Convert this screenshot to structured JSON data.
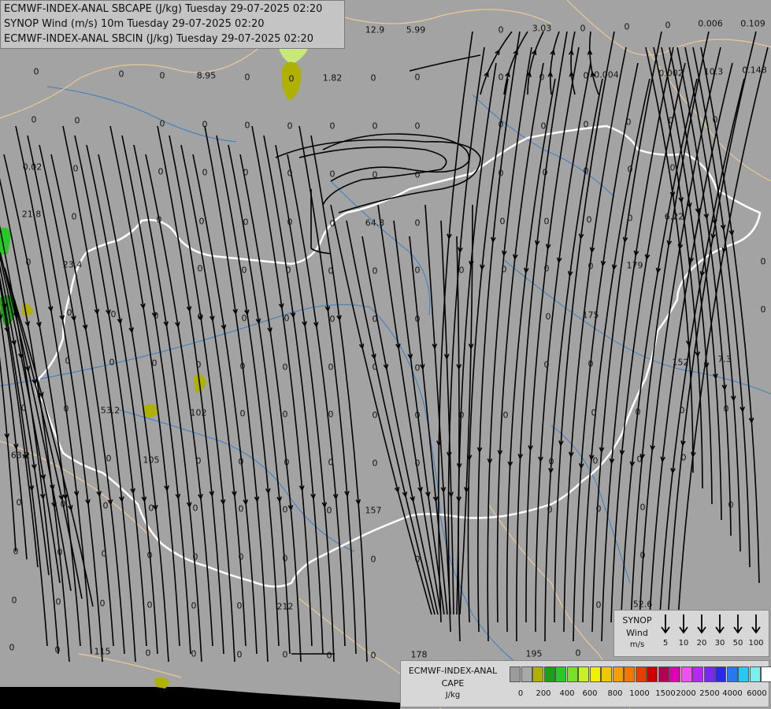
{
  "titles": [
    "ECMWF-INDEX-ANAL SBCAPE (J/kg) Tuesday 29-07-2025 02:20",
    "SYNOP Wind (m/s) 10m Tuesday 29-07-2025 02:20",
    "ECMWF-INDEX-ANAL SBCIN (J/kg) Tuesday 29-07-2025 02:20"
  ],
  "colors": {
    "background": "#a3a3a3",
    "border_white": "#ffffff",
    "region_lines": "#e8c99a",
    "rivers": "#3a7fc4",
    "streamlines": "#000000",
    "sea_black": "#000000"
  },
  "values": [
    {
      "t": "0"
    },
    {
      "t": "12.9"
    },
    {
      "t": "5.99"
    },
    {
      "t": "0"
    },
    {
      "t": "3.03"
    },
    {
      "t": "0"
    },
    {
      "t": "0"
    },
    {
      "t": "0"
    },
    {
      "t": "0.006"
    },
    {
      "t": "0.109"
    },
    {
      "t": "0"
    },
    {
      "t": "0"
    },
    {
      "t": "0"
    },
    {
      "t": "8.95"
    },
    {
      "t": "0"
    },
    {
      "t": "0"
    },
    {
      "t": "1.82"
    },
    {
      "t": "0"
    },
    {
      "t": "0"
    },
    {
      "t": "0"
    },
    {
      "t": "0"
    },
    {
      "t": "0"
    },
    {
      "t": "0.004"
    },
    {
      "t": "0.002"
    },
    {
      "t": "10.3"
    },
    {
      "t": "0.148"
    },
    {
      "t": "0"
    },
    {
      "t": "0"
    },
    {
      "t": "0"
    },
    {
      "t": "0"
    },
    {
      "t": "0"
    },
    {
      "t": "0"
    },
    {
      "t": "0"
    },
    {
      "t": "0"
    },
    {
      "t": "0"
    },
    {
      "t": "0"
    },
    {
      "t": "0"
    },
    {
      "t": "0"
    },
    {
      "t": "0"
    },
    {
      "t": "0"
    },
    {
      "t": "0"
    },
    {
      "t": "0.02"
    },
    {
      "t": "0"
    },
    {
      "t": "0"
    },
    {
      "t": "0"
    },
    {
      "t": "0"
    },
    {
      "t": "0"
    },
    {
      "t": "0"
    },
    {
      "t": "0"
    },
    {
      "t": "0"
    },
    {
      "t": "0"
    },
    {
      "t": "0"
    },
    {
      "t": "0"
    },
    {
      "t": "0"
    },
    {
      "t": "0"
    },
    {
      "t": "21.8"
    },
    {
      "t": "0"
    },
    {
      "t": "0"
    },
    {
      "t": "0"
    },
    {
      "t": "0"
    },
    {
      "t": "0"
    },
    {
      "t": "0"
    },
    {
      "t": "64.3"
    },
    {
      "t": "0"
    },
    {
      "t": "0"
    },
    {
      "t": "0"
    },
    {
      "t": "0"
    },
    {
      "t": "0"
    },
    {
      "t": "6.22"
    },
    {
      "t": "0"
    },
    {
      "t": "23.4"
    },
    {
      "t": "0"
    },
    {
      "t": "0"
    },
    {
      "t": "0"
    },
    {
      "t": "0"
    },
    {
      "t": "0"
    },
    {
      "t": "0"
    },
    {
      "t": "0"
    },
    {
      "t": "0"
    },
    {
      "t": "0"
    },
    {
      "t": "0"
    },
    {
      "t": "179"
    },
    {
      "t": "0"
    },
    {
      "t": "0"
    },
    {
      "t": "0"
    },
    {
      "t": "0"
    },
    {
      "t": "0"
    },
    {
      "t": "0"
    },
    {
      "t": "0"
    },
    {
      "t": "0"
    },
    {
      "t": "0"
    },
    {
      "t": "0"
    },
    {
      "t": "0"
    },
    {
      "t": "175"
    },
    {
      "t": "0"
    },
    {
      "t": "0"
    },
    {
      "t": "0"
    },
    {
      "t": "0"
    },
    {
      "t": "0"
    },
    {
      "t": "0"
    },
    {
      "t": "0"
    },
    {
      "t": "0"
    },
    {
      "t": "0"
    },
    {
      "t": "0"
    },
    {
      "t": "0"
    },
    {
      "t": "0"
    },
    {
      "t": "152"
    },
    {
      "t": "7.3"
    },
    {
      "t": "0"
    },
    {
      "t": "0"
    },
    {
      "t": "53.2"
    },
    {
      "t": "102"
    },
    {
      "t": "0"
    },
    {
      "t": "0"
    },
    {
      "t": "0"
    },
    {
      "t": "0"
    },
    {
      "t": "0"
    },
    {
      "t": "0"
    },
    {
      "t": "0"
    },
    {
      "t": "0"
    },
    {
      "t": "0"
    },
    {
      "t": "0"
    },
    {
      "t": "0"
    },
    {
      "t": "63.2"
    },
    {
      "t": "0"
    },
    {
      "t": "105"
    },
    {
      "t": "0"
    },
    {
      "t": "0"
    },
    {
      "t": "0"
    },
    {
      "t": "0"
    },
    {
      "t": "0"
    },
    {
      "t": "0"
    },
    {
      "t": "0"
    },
    {
      "t": "0"
    },
    {
      "t": "0"
    },
    {
      "t": "0"
    },
    {
      "t": "0"
    },
    {
      "t": "0"
    },
    {
      "t": "0"
    },
    {
      "t": "0"
    },
    {
      "t": "0"
    },
    {
      "t": "0"
    },
    {
      "t": "0"
    },
    {
      "t": "0"
    },
    {
      "t": "157"
    },
    {
      "t": "0"
    },
    {
      "t": "0"
    },
    {
      "t": "0"
    },
    {
      "t": "0"
    },
    {
      "t": "0"
    },
    {
      "t": "0"
    },
    {
      "t": "0"
    },
    {
      "t": "0"
    },
    {
      "t": "0"
    },
    {
      "t": "0"
    },
    {
      "t": "0"
    },
    {
      "t": "0"
    },
    {
      "t": "0"
    },
    {
      "t": "0"
    },
    {
      "t": "0"
    },
    {
      "t": "0"
    },
    {
      "t": "0"
    },
    {
      "t": "0"
    },
    {
      "t": "0"
    },
    {
      "t": "0"
    },
    {
      "t": "212"
    },
    {
      "t": "0"
    },
    {
      "t": "52.6"
    },
    {
      "t": "0"
    },
    {
      "t": "0"
    },
    {
      "t": "115"
    },
    {
      "t": "0"
    },
    {
      "t": "0"
    },
    {
      "t": "0"
    },
    {
      "t": "0"
    },
    {
      "t": "0"
    },
    {
      "t": "0"
    },
    {
      "t": "178"
    },
    {
      "t": "195"
    },
    {
      "t": "0"
    },
    {
      "t": "0"
    },
    {
      "t": "0"
    }
  ],
  "synop_legend": {
    "title": "SYNOP",
    "wind": "Wind",
    "unit": "m/s",
    "speeds": [
      "5",
      "10",
      "20",
      "30",
      "50",
      "100"
    ]
  },
  "cape_legend": {
    "title_line1": "ECMWF-INDEX-ANAL",
    "title_line2": "CAPE",
    "unit": "J/kg",
    "ticks": [
      "0",
      "200",
      "400",
      "600",
      "800",
      "1000",
      "1500",
      "2000",
      "2500",
      "4000",
      "6000"
    ],
    "swatch_colors": [
      "#9b9b9b",
      "#a8a8a8",
      "#b0b000",
      "#1ca01c",
      "#28c828",
      "#78e028",
      "#c8f028",
      "#f0f000",
      "#f0c800",
      "#f0a000",
      "#f07800",
      "#e04000",
      "#c80000",
      "#b40050",
      "#e000b4",
      "#f050f0",
      "#b428f0",
      "#7828f0",
      "#2828f0",
      "#2878f0",
      "#28c8f0",
      "#78f0f0",
      "#ffffff"
    ]
  }
}
